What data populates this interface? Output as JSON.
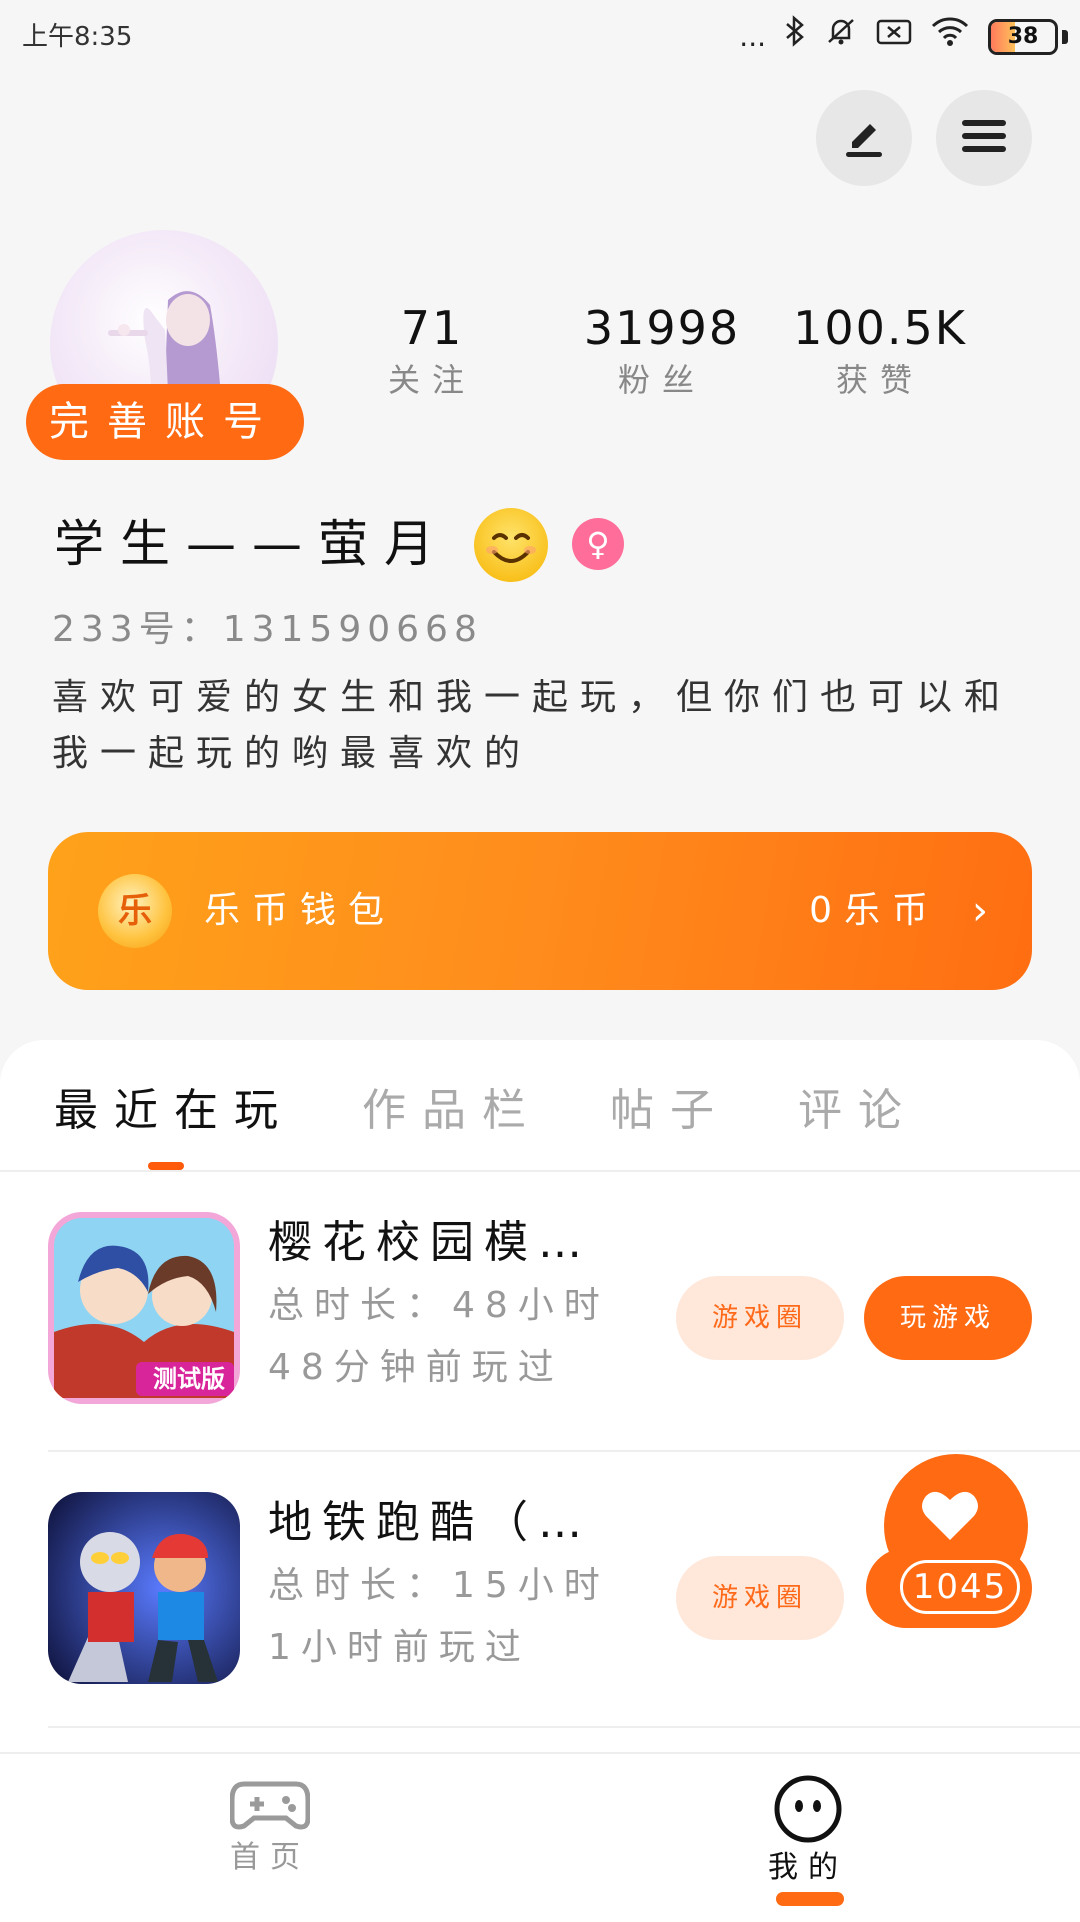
{
  "status_bar": {
    "time": "上午8:35",
    "more": "...",
    "icons": [
      "bluetooth-icon",
      "mute-icon",
      "sim-icon",
      "wifi-icon",
      "battery-icon"
    ],
    "battery_level": 38,
    "battery_label": "38"
  },
  "header": {
    "edit_icon": "edit-icon",
    "menu_icon": "menu-icon"
  },
  "profile": {
    "perfect_account_label": "完善账号",
    "stats": [
      {
        "value": "71",
        "label": "关注"
      },
      {
        "value": "31998",
        "label": "粉丝"
      },
      {
        "value": "100.5K",
        "label": "获赞"
      }
    ],
    "nickname": "学生——萤月",
    "gender_symbol": "♀",
    "uid": "233号：131590668",
    "bio": "喜欢可爱的女生和我一起玩，但你们也可以和我一起玩的哟最喜欢的"
  },
  "wallet": {
    "coin_char": "乐",
    "label": "乐币钱包",
    "amount": "0乐币",
    "chevron": "›"
  },
  "tabs": [
    {
      "label": "最近在玩",
      "active": true
    },
    {
      "label": "作品栏",
      "active": false
    },
    {
      "label": "帖子",
      "active": false
    },
    {
      "label": "评论",
      "active": false
    }
  ],
  "games": [
    {
      "name": "樱花校园模…",
      "duration": "总时长：48小时",
      "last_played": "48分钟前玩过",
      "circle_label": "游戏圈",
      "play_label": "玩游戏",
      "icon_badge": "测试版"
    },
    {
      "name": "地铁跑酷（…",
      "duration": "总时长：15小时",
      "last_played": "1小时前玩过",
      "circle_label": "游戏圈"
    }
  ],
  "like_widget": {
    "count": "1045"
  },
  "bottom_nav": [
    {
      "label": "首页",
      "icon": "gamepad-icon",
      "active": false
    },
    {
      "label": "我的",
      "icon": "face-icon",
      "active": true
    }
  ],
  "colors": {
    "accent": "#ff6a13",
    "wallet_start": "#ffa21a",
    "wallet_end": "#ff6e12",
    "pill_light": "#ffe7da",
    "gender_pink": "#ff6e9a"
  }
}
